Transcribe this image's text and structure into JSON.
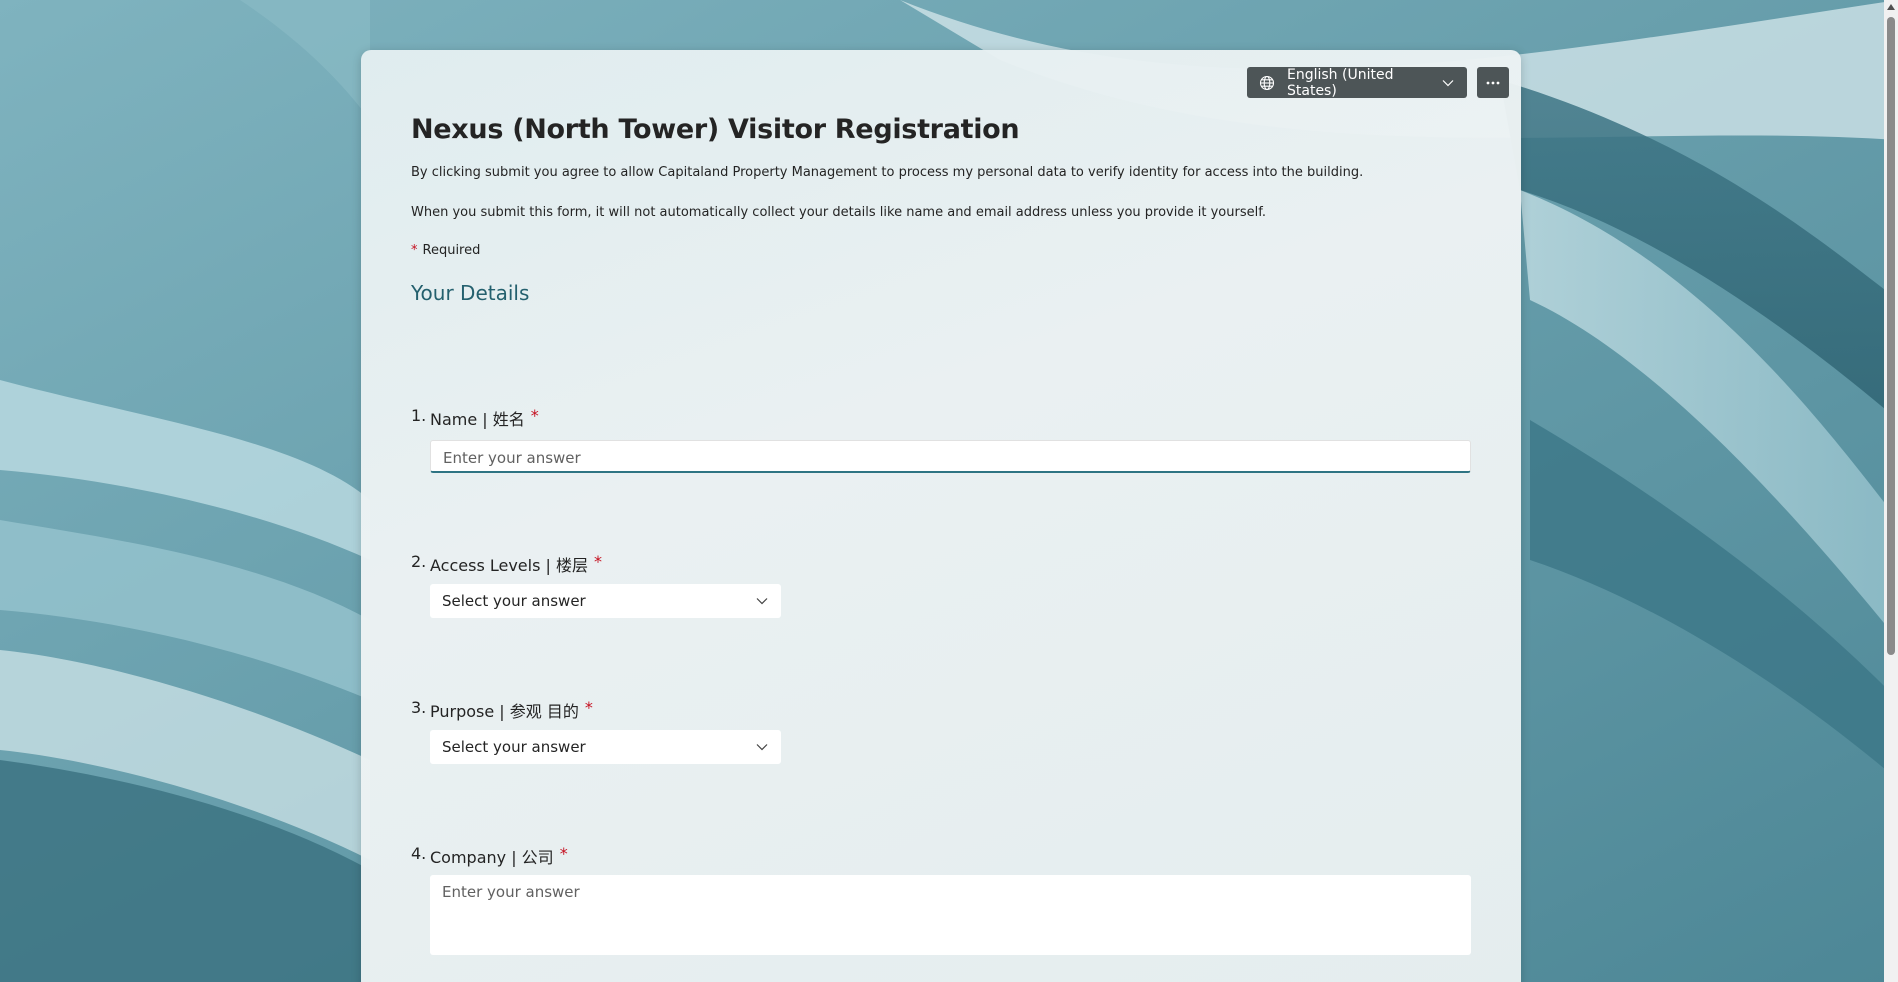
{
  "header": {
    "language_label": "English (United States)",
    "language_icon": "globe-icon",
    "more_icon": "more-options-icon"
  },
  "form": {
    "title": "Nexus (North Tower) Visitor Registration",
    "description_1": "By clicking submit you agree to allow Capitaland Property Management to process my personal data to verify identity for access into the building.",
    "description_2": "When you submit this form, it will not automatically collect your details like name and email address unless you provide it yourself.",
    "required_star": "*",
    "required_text": "Required",
    "section_title": "Your Details"
  },
  "questions": [
    {
      "number": "1.",
      "label": "Name | 姓名",
      "star": "*",
      "type": "text",
      "placeholder": "Enter your answer"
    },
    {
      "number": "2.",
      "label": "Access Levels | 楼层",
      "star": "*",
      "type": "select",
      "placeholder": "Select your answer"
    },
    {
      "number": "3.",
      "label": "Purpose | 参观 目的",
      "star": "*",
      "type": "select",
      "placeholder": "Select your answer"
    },
    {
      "number": "4.",
      "label": "Company | 公司",
      "star": "*",
      "type": "textarea",
      "placeholder": "Enter your answer"
    }
  ],
  "theme": {
    "accent": "#2e7483",
    "section_color": "#24606e",
    "required_color": "#c50f1f",
    "toolbar_bg": "#4d5557"
  }
}
